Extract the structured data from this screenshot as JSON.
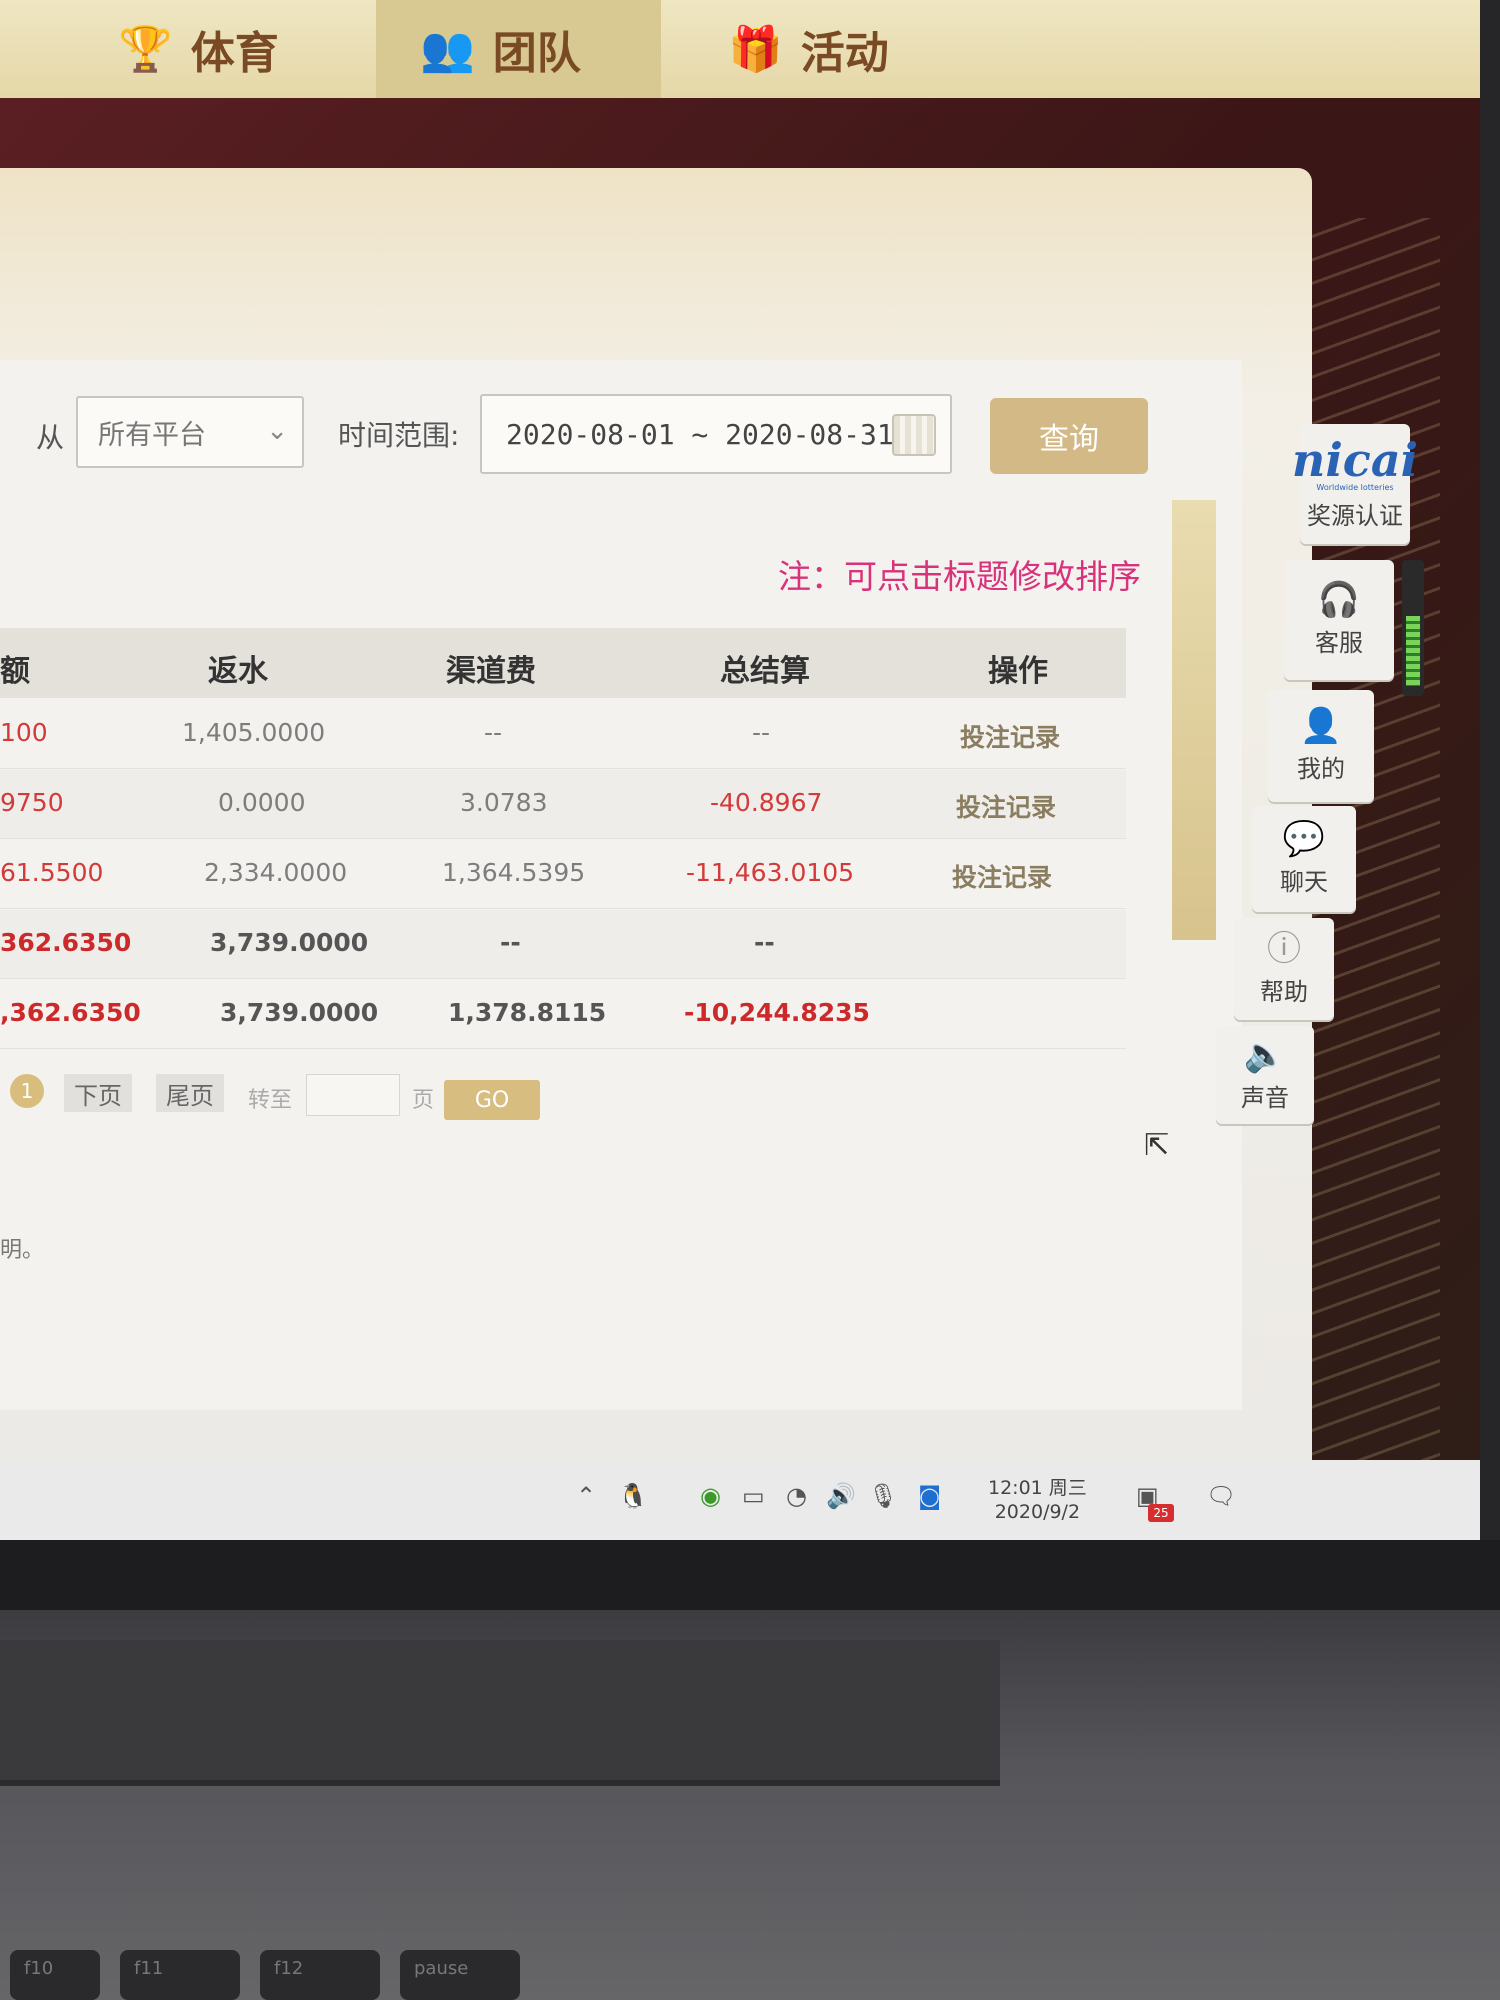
{
  "nav": {
    "tabs": [
      {
        "label": "体育",
        "icon": "trophy-icon"
      },
      {
        "label": "团队",
        "icon": "team-icon"
      },
      {
        "label": "活动",
        "icon": "gift-icon"
      }
    ]
  },
  "filters": {
    "from_label": "从",
    "platform_value": "所有平台",
    "time_range_label": "时间范围:",
    "date_range_value": "2020-08-01 ~ 2020-08-31",
    "query_label": "查询"
  },
  "note": "注：可点击标题修改排序",
  "table": {
    "headers": [
      "额",
      "返水",
      "渠道费",
      "总结算",
      "操作"
    ],
    "rows": [
      {
        "amount": "100",
        "rebate": "1,405.0000",
        "channel_fee": "--",
        "total": "--",
        "action": "投注记录"
      },
      {
        "amount": "9750",
        "rebate": "0.0000",
        "channel_fee": "3.0783",
        "total": "-40.8967",
        "action": "投注记录"
      },
      {
        "amount": "61.5500",
        "rebate": "2,334.0000",
        "channel_fee": "1,364.5395",
        "total": "-11,463.0105",
        "action": "投注记录"
      },
      {
        "amount": "362.6350",
        "rebate": "3,739.0000",
        "channel_fee": "--",
        "total": "--",
        "action": ""
      },
      {
        "amount": ",362.6350",
        "rebate": "3,739.0000",
        "channel_fee": "1,378.8115",
        "total": "-10,244.8235",
        "action": ""
      }
    ]
  },
  "pagination": {
    "current_page": "1",
    "next_label": "下页",
    "last_label": "尾页",
    "goto_label": "转至",
    "page_unit": "页",
    "go_label": "GO"
  },
  "footer_fragment": "明。",
  "side_panel": {
    "logo_text": "nicai",
    "logo_sub": "Worldwide lotteries",
    "items": [
      {
        "label": "奖源认证",
        "icon": "certification-icon"
      },
      {
        "label": "客服",
        "icon": "headset-icon"
      },
      {
        "label": "我的",
        "icon": "user-icon"
      },
      {
        "label": "聊天",
        "icon": "chat-icon"
      },
      {
        "label": "帮助",
        "icon": "help-icon"
      },
      {
        "label": "声音",
        "icon": "sound-icon"
      }
    ]
  },
  "taskbar": {
    "time": "12:01 周三",
    "date": "2020/9/2",
    "notification_count": "25"
  },
  "keyboard": {
    "keys": [
      "f10",
      "f11",
      "f12",
      "pause"
    ]
  },
  "colors": {
    "accent_gold": "#d3b985",
    "negative_red": "#d33a3a",
    "note_pink": "#d8327a",
    "nav_brown": "#7a4a24"
  }
}
